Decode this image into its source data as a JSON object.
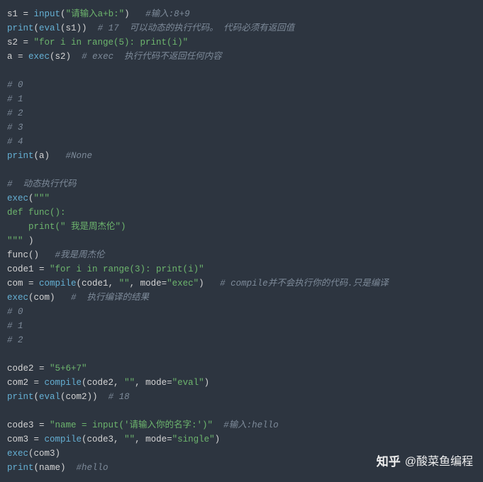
{
  "lines": [
    {
      "segments": [
        {
          "t": "s1 ",
          "cls": "n"
        },
        {
          "t": "= ",
          "cls": "p"
        },
        {
          "t": "input",
          "cls": "fn"
        },
        {
          "t": "(",
          "cls": "p"
        },
        {
          "t": "\"请输入a+b:\"",
          "cls": "s"
        },
        {
          "t": ")   ",
          "cls": "p"
        },
        {
          "t": "#输入:8+9",
          "cls": "c"
        }
      ]
    },
    {
      "segments": [
        {
          "t": "print",
          "cls": "fn"
        },
        {
          "t": "(",
          "cls": "p"
        },
        {
          "t": "eval",
          "cls": "fn"
        },
        {
          "t": "(s1))  ",
          "cls": "p"
        },
        {
          "t": "# 17  可以动态的执行代码。 代码必须有返回值",
          "cls": "c"
        }
      ]
    },
    {
      "segments": [
        {
          "t": "s2 ",
          "cls": "n"
        },
        {
          "t": "= ",
          "cls": "p"
        },
        {
          "t": "\"for i in range(5): print(i)\"",
          "cls": "s"
        }
      ]
    },
    {
      "segments": [
        {
          "t": "a ",
          "cls": "n"
        },
        {
          "t": "= ",
          "cls": "p"
        },
        {
          "t": "exec",
          "cls": "fn"
        },
        {
          "t": "(s2)  ",
          "cls": "p"
        },
        {
          "t": "# exec  执行代码不返回任何内容",
          "cls": "c"
        }
      ]
    },
    {
      "segments": [
        {
          "t": " ",
          "cls": "p"
        }
      ]
    },
    {
      "segments": [
        {
          "t": "# 0",
          "cls": "c"
        }
      ]
    },
    {
      "segments": [
        {
          "t": "# 1",
          "cls": "c"
        }
      ]
    },
    {
      "segments": [
        {
          "t": "# 2",
          "cls": "c"
        }
      ]
    },
    {
      "segments": [
        {
          "t": "# 3",
          "cls": "c"
        }
      ]
    },
    {
      "segments": [
        {
          "t": "# 4",
          "cls": "c"
        }
      ]
    },
    {
      "segments": [
        {
          "t": "print",
          "cls": "fn"
        },
        {
          "t": "(a)   ",
          "cls": "p"
        },
        {
          "t": "#None",
          "cls": "c"
        }
      ]
    },
    {
      "segments": [
        {
          "t": " ",
          "cls": "p"
        }
      ]
    },
    {
      "segments": [
        {
          "t": "#  动态执行代码",
          "cls": "c"
        }
      ]
    },
    {
      "segments": [
        {
          "t": "exec",
          "cls": "fn"
        },
        {
          "t": "(",
          "cls": "p"
        },
        {
          "t": "\"\"\"",
          "cls": "s"
        }
      ]
    },
    {
      "segments": [
        {
          "t": "def func():",
          "cls": "s"
        }
      ]
    },
    {
      "segments": [
        {
          "t": "    print(\" 我是周杰伦\")",
          "cls": "s"
        }
      ]
    },
    {
      "segments": [
        {
          "t": "\"\"\" ",
          "cls": "s"
        },
        {
          "t": ")",
          "cls": "p"
        }
      ]
    },
    {
      "segments": [
        {
          "t": "func()   ",
          "cls": "p"
        },
        {
          "t": "#我是周杰伦",
          "cls": "c"
        }
      ]
    },
    {
      "segments": [
        {
          "t": "code1 ",
          "cls": "n"
        },
        {
          "t": "= ",
          "cls": "p"
        },
        {
          "t": "\"for i in range(3): print(i)\"",
          "cls": "s"
        }
      ]
    },
    {
      "segments": [
        {
          "t": "com ",
          "cls": "n"
        },
        {
          "t": "= ",
          "cls": "p"
        },
        {
          "t": "compile",
          "cls": "fn"
        },
        {
          "t": "(code1, ",
          "cls": "p"
        },
        {
          "t": "\"\"",
          "cls": "s"
        },
        {
          "t": ", mode",
          "cls": "p"
        },
        {
          "t": "=",
          "cls": "p"
        },
        {
          "t": "\"exec\"",
          "cls": "s"
        },
        {
          "t": ")   ",
          "cls": "p"
        },
        {
          "t": "# compile并不会执行你的代码.只是编译",
          "cls": "c"
        }
      ]
    },
    {
      "segments": [
        {
          "t": "exec",
          "cls": "fn"
        },
        {
          "t": "(com)   ",
          "cls": "p"
        },
        {
          "t": "#  执行编译的结果",
          "cls": "c"
        }
      ]
    },
    {
      "segments": [
        {
          "t": "# 0",
          "cls": "c"
        }
      ]
    },
    {
      "segments": [
        {
          "t": "# 1",
          "cls": "c"
        }
      ]
    },
    {
      "segments": [
        {
          "t": "# 2",
          "cls": "c"
        }
      ]
    },
    {
      "segments": [
        {
          "t": " ",
          "cls": "p"
        }
      ]
    },
    {
      "segments": [
        {
          "t": "code2 ",
          "cls": "n"
        },
        {
          "t": "= ",
          "cls": "p"
        },
        {
          "t": "\"5+6+7\"",
          "cls": "s"
        }
      ]
    },
    {
      "segments": [
        {
          "t": "com2 ",
          "cls": "n"
        },
        {
          "t": "= ",
          "cls": "p"
        },
        {
          "t": "compile",
          "cls": "fn"
        },
        {
          "t": "(code2, ",
          "cls": "p"
        },
        {
          "t": "\"\"",
          "cls": "s"
        },
        {
          "t": ", mode",
          "cls": "p"
        },
        {
          "t": "=",
          "cls": "p"
        },
        {
          "t": "\"eval\"",
          "cls": "s"
        },
        {
          "t": ")",
          "cls": "p"
        }
      ]
    },
    {
      "segments": [
        {
          "t": "print",
          "cls": "fn"
        },
        {
          "t": "(",
          "cls": "p"
        },
        {
          "t": "eval",
          "cls": "fn"
        },
        {
          "t": "(com2))  ",
          "cls": "p"
        },
        {
          "t": "# 18",
          "cls": "c"
        }
      ]
    },
    {
      "segments": [
        {
          "t": " ",
          "cls": "p"
        }
      ]
    },
    {
      "segments": [
        {
          "t": "code3 ",
          "cls": "n"
        },
        {
          "t": "= ",
          "cls": "p"
        },
        {
          "t": "\"name = input('请输入你的名字:')\"",
          "cls": "s"
        },
        {
          "t": "  ",
          "cls": "p"
        },
        {
          "t": "#输入:hello",
          "cls": "c"
        }
      ]
    },
    {
      "segments": [
        {
          "t": "com3 ",
          "cls": "n"
        },
        {
          "t": "= ",
          "cls": "p"
        },
        {
          "t": "compile",
          "cls": "fn"
        },
        {
          "t": "(code3, ",
          "cls": "p"
        },
        {
          "t": "\"\"",
          "cls": "s"
        },
        {
          "t": ", mode",
          "cls": "p"
        },
        {
          "t": "=",
          "cls": "p"
        },
        {
          "t": "\"single\"",
          "cls": "s"
        },
        {
          "t": ")",
          "cls": "p"
        }
      ]
    },
    {
      "segments": [
        {
          "t": "exec",
          "cls": "fn"
        },
        {
          "t": "(com3)",
          "cls": "p"
        }
      ]
    },
    {
      "segments": [
        {
          "t": "print",
          "cls": "fn"
        },
        {
          "t": "(name)  ",
          "cls": "p"
        },
        {
          "t": "#hello",
          "cls": "c"
        }
      ]
    }
  ],
  "watermark": {
    "logo": "知乎",
    "text": "@酸菜鱼编程"
  }
}
